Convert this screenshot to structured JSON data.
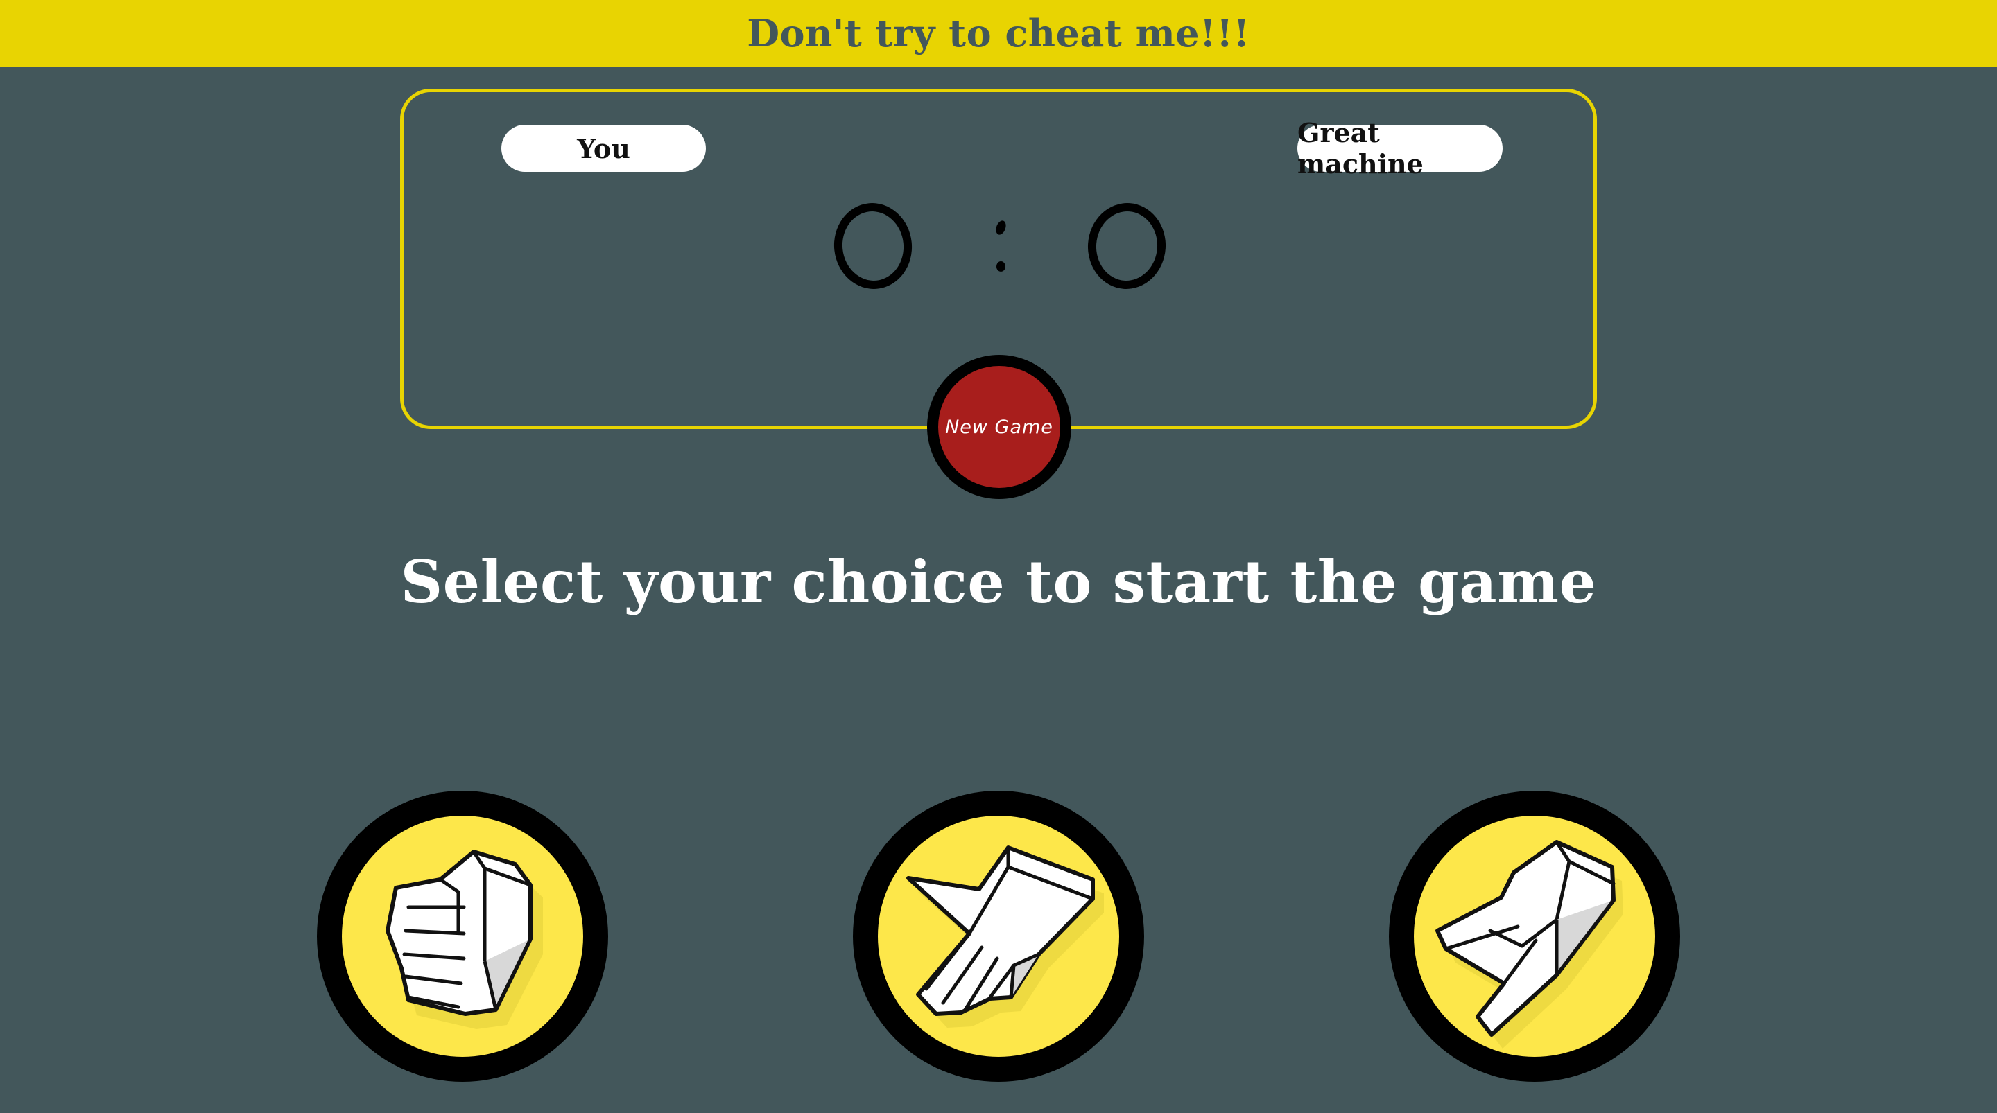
{
  "header": {
    "title": "Don't try to cheat me!!!"
  },
  "scoreboard": {
    "player_label": "You",
    "machine_label": "Great machine",
    "player_score": "0",
    "machine_score": "0"
  },
  "new_game_label": "New Game",
  "prompt": "Select your choice to start the game",
  "choices": [
    {
      "id": "rock",
      "icon": "rock-hand-icon"
    },
    {
      "id": "paper",
      "icon": "paper-hand-icon"
    },
    {
      "id": "scissors",
      "icon": "scissors-hand-icon"
    }
  ],
  "colors": {
    "background": "#43575b",
    "accent_yellow": "#e8d402",
    "choice_yellow": "#fde74a",
    "new_game_red": "#a81e1c"
  }
}
